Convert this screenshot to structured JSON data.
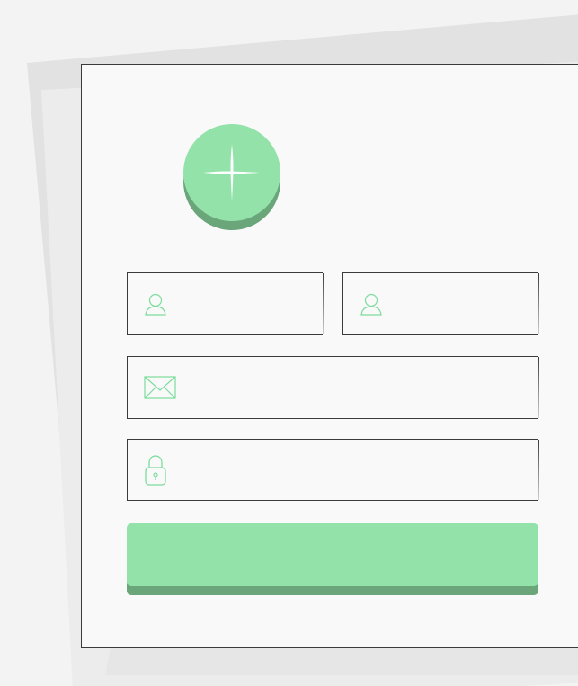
{
  "form": {
    "avatar": {
      "icon": "plus-sparkle-icon"
    },
    "fields": {
      "first_name": {
        "value": "",
        "placeholder": "",
        "icon": "user-icon"
      },
      "last_name": {
        "value": "",
        "placeholder": "",
        "icon": "user-icon"
      },
      "email": {
        "value": "",
        "placeholder": "",
        "icon": "envelope-icon"
      },
      "password": {
        "value": "",
        "placeholder": "",
        "icon": "padlock-icon"
      }
    },
    "submit": {
      "label": ""
    }
  },
  "colors": {
    "accent": "#92e2a9",
    "accent_dark": "#6aa67a",
    "icon_stroke": "#7ddc9c",
    "card_bg": "#f9f9f9",
    "page_bg": "#f3f3f3"
  }
}
